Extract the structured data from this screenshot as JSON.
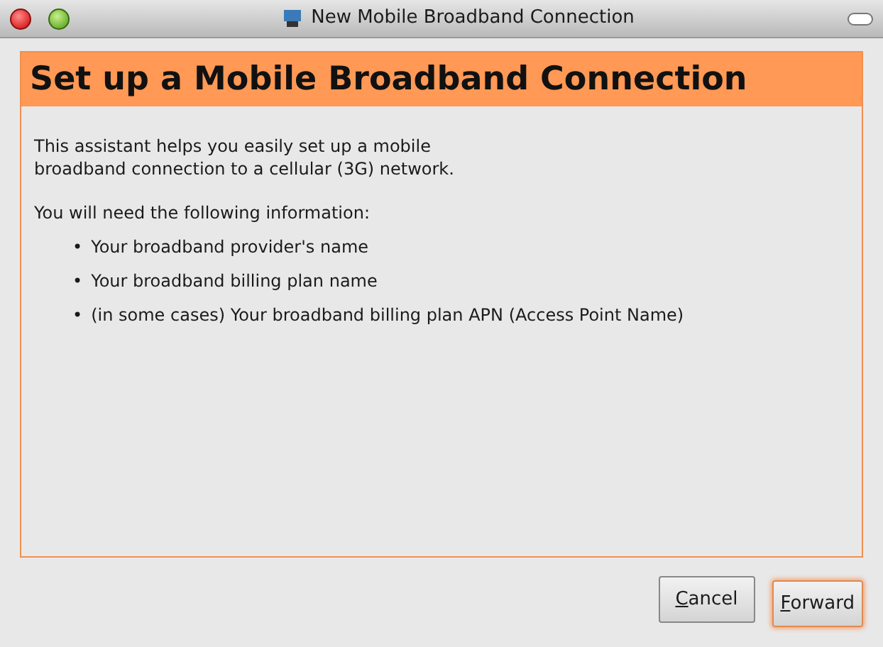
{
  "window": {
    "title": "New Mobile Broadband Connection"
  },
  "page": {
    "heading": "Set up a Mobile Broadband Connection",
    "intro": [
      "This assistant helps you easily set up a mobile",
      "broadband connection to a cellular (3G) network."
    ],
    "info_label": "You will need the following information:",
    "bullets": [
      {
        "marker": "•",
        "text": "Your broadband provider's name"
      },
      {
        "marker": "•",
        "text": "Your broadband billing plan name"
      },
      {
        "marker": "•",
        "text": "(in some cases) Your broadband billing plan APN (Access Point Name)"
      }
    ]
  },
  "buttons": [
    {
      "label": "Cancel",
      "default": false
    },
    {
      "label": "Forward",
      "default": true
    }
  ]
}
